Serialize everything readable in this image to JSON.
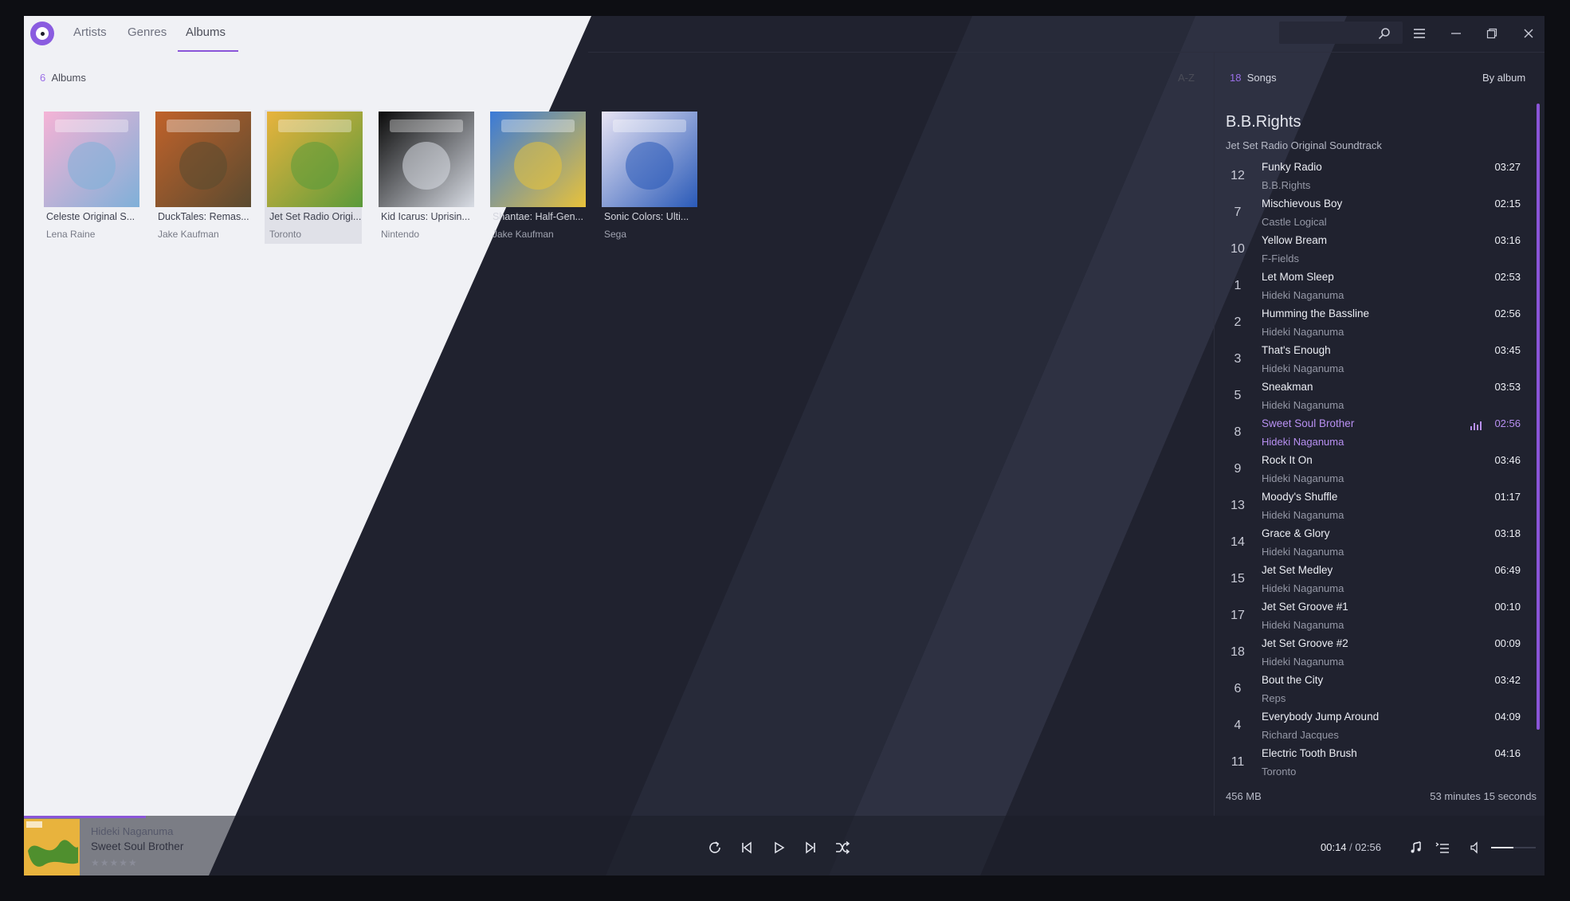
{
  "tabs": [
    {
      "label": "Artists"
    },
    {
      "label": "Genres"
    },
    {
      "label": "Albums",
      "active": true
    }
  ],
  "titlebar": {
    "icons": [
      "search-icon",
      "menu-icon",
      "minimize-icon",
      "restore-icon",
      "close-icon"
    ]
  },
  "albums_header": {
    "count": "6",
    "label": "Albums",
    "sort": "A-Z"
  },
  "albums": [
    {
      "title": "Celeste Original S...",
      "artist": "Lena Raine",
      "art_colors": [
        "#f5b3d6",
        "#7fb0d8"
      ]
    },
    {
      "title": "DuckTales: Remas...",
      "artist": "Jake Kaufman",
      "art_colors": [
        "#c0622a",
        "#5a4a30"
      ]
    },
    {
      "title": "Jet Set Radio Origi...",
      "artist": "Toronto",
      "selected": true,
      "art_colors": [
        "#e8b33d",
        "#5a9a3a"
      ]
    },
    {
      "title": "Kid Icarus: Uprisin...",
      "artist": "Nintendo",
      "art_colors": [
        "#0a0a0a",
        "#d8dce4"
      ]
    },
    {
      "title": "Shantae: Half-Gen...",
      "artist": "Jake Kaufman",
      "art_colors": [
        "#3a7ad8",
        "#e8c23a"
      ]
    },
    {
      "title": "Sonic Colors: Ulti...",
      "artist": "Sega",
      "art_colors": [
        "#e8e4f4",
        "#2a5ab8"
      ]
    }
  ],
  "songs_header": {
    "count": "18",
    "label": "Songs",
    "sort": "By album"
  },
  "album_group": {
    "title": "B.B.Rights",
    "subtitle": "Jet Set Radio Original Soundtrack"
  },
  "songs": [
    {
      "track": "12",
      "title": "Funky Radio",
      "artist": "B.B.Rights",
      "duration": "03:27"
    },
    {
      "track": "7",
      "title": "Mischievous Boy",
      "artist": "Castle Logical",
      "duration": "02:15"
    },
    {
      "track": "10",
      "title": "Yellow Bream",
      "artist": "F-Fields",
      "duration": "03:16"
    },
    {
      "track": "1",
      "title": "Let Mom Sleep",
      "artist": "Hideki Naganuma",
      "duration": "02:53"
    },
    {
      "track": "2",
      "title": "Humming the Bassline",
      "artist": "Hideki Naganuma",
      "duration": "02:56"
    },
    {
      "track": "3",
      "title": "That's Enough",
      "artist": "Hideki Naganuma",
      "duration": "03:45"
    },
    {
      "track": "5",
      "title": "Sneakman",
      "artist": "Hideki Naganuma",
      "duration": "03:53"
    },
    {
      "track": "8",
      "title": "Sweet Soul Brother",
      "artist": "Hideki Naganuma",
      "duration": "02:56",
      "playing": true
    },
    {
      "track": "9",
      "title": "Rock It On",
      "artist": "Hideki Naganuma",
      "duration": "03:46"
    },
    {
      "track": "13",
      "title": "Moody's Shuffle",
      "artist": "Hideki Naganuma",
      "duration": "01:17"
    },
    {
      "track": "14",
      "title": "Grace & Glory",
      "artist": "Hideki Naganuma",
      "duration": "03:18"
    },
    {
      "track": "15",
      "title": "Jet Set Medley",
      "artist": "Hideki Naganuma",
      "duration": "06:49"
    },
    {
      "track": "17",
      "title": "Jet Set Groove #1",
      "artist": "Hideki Naganuma",
      "duration": "00:10"
    },
    {
      "track": "18",
      "title": "Jet Set Groove #2",
      "artist": "Hideki Naganuma",
      "duration": "00:09"
    },
    {
      "track": "6",
      "title": "Bout the City",
      "artist": "Reps",
      "duration": "03:42"
    },
    {
      "track": "4",
      "title": "Everybody Jump Around",
      "artist": "Richard Jacques",
      "duration": "04:09"
    },
    {
      "track": "11",
      "title": "Electric Tooth Brush",
      "artist": "Toronto",
      "duration": "04:16"
    }
  ],
  "footer": {
    "size": "456 MB",
    "total_time": "53 minutes 15 seconds"
  },
  "player": {
    "artist": "Hideki Naganuma",
    "title": "Sweet Soul Brother",
    "stars": "★★★★★",
    "current_time": "00:14",
    "separator": "/",
    "total_time": "02:56",
    "progress": 0.08,
    "volume": 0.5
  },
  "colors": {
    "accent": "#8a55d8",
    "accent_light": "#b890f2",
    "dark_bg": "#20222f",
    "light_bg": "#f0f1f5"
  }
}
